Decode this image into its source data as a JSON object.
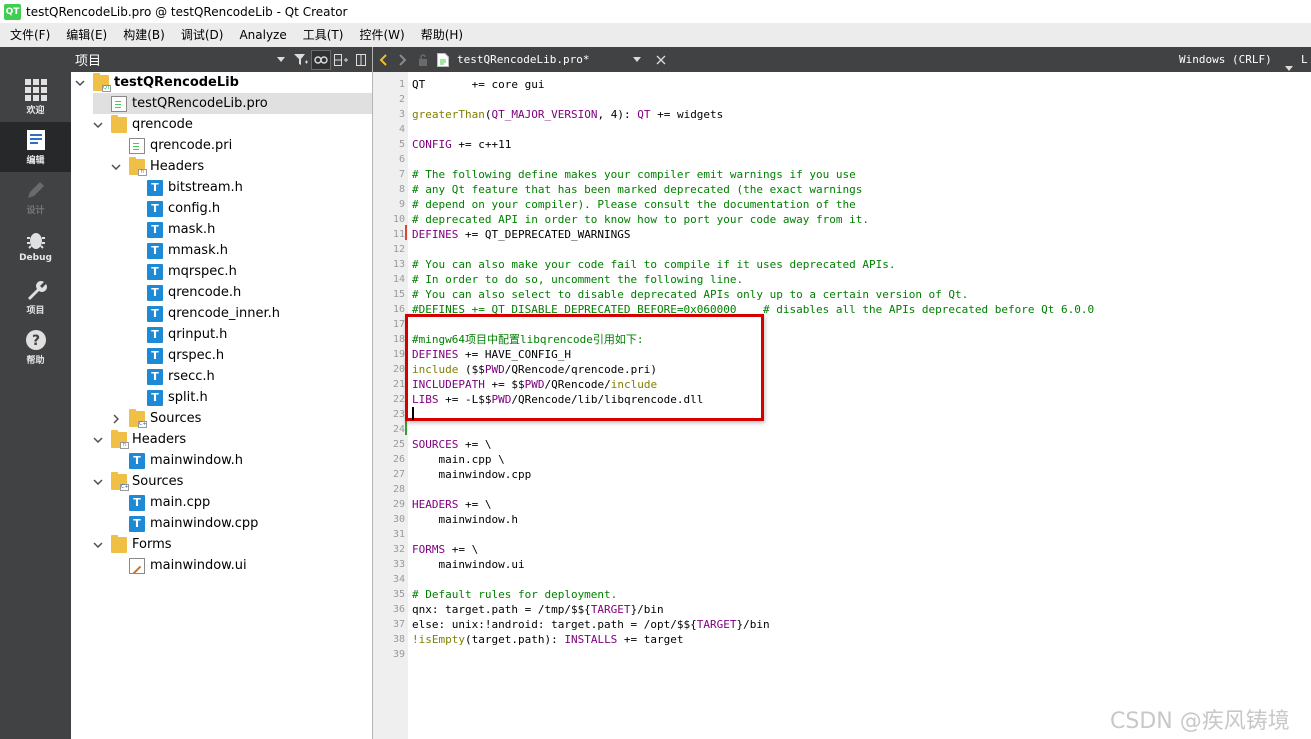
{
  "window": {
    "logo": "QT",
    "title": "testQRencodeLib.pro @ testQRencodeLib - Qt Creator"
  },
  "menubar": [
    "文件(F)",
    "编辑(E)",
    "构建(B)",
    "调试(D)",
    "Analyze",
    "工具(T)",
    "控件(W)",
    "帮助(H)"
  ],
  "modes": [
    {
      "label": "欢迎",
      "icon": "grid-icon",
      "active": false,
      "disabled": false
    },
    {
      "label": "编辑",
      "icon": "edit-icon",
      "active": true,
      "disabled": false
    },
    {
      "label": "设计",
      "icon": "pencil-icon",
      "active": false,
      "disabled": true
    },
    {
      "label": "Debug",
      "icon": "bug-icon",
      "active": false,
      "disabled": false
    },
    {
      "label": "项目",
      "icon": "wrench-icon",
      "active": false,
      "disabled": false
    },
    {
      "label": "帮助",
      "icon": "help-icon",
      "active": false,
      "disabled": false
    }
  ],
  "project_pane": {
    "title": "项目",
    "tree": [
      {
        "label": "testQRencodeLib",
        "icon": "project-folder-icon",
        "level": 0,
        "expanded": true,
        "bold": true
      },
      {
        "label": "testQRencodeLib.pro",
        "icon": "pro-file-icon",
        "level": 1,
        "selected": true
      },
      {
        "label": "qrencode",
        "icon": "folder-icon",
        "level": 1,
        "expanded": true
      },
      {
        "label": "qrencode.pri",
        "icon": "pri-file-icon",
        "level": 2
      },
      {
        "label": "Headers",
        "icon": "headers-folder-icon",
        "level": 2,
        "expanded": true
      },
      {
        "label": "bitstream.h",
        "icon": "header-file-icon",
        "level": 3
      },
      {
        "label": "config.h",
        "icon": "header-file-icon",
        "level": 3
      },
      {
        "label": "mask.h",
        "icon": "header-file-icon",
        "level": 3
      },
      {
        "label": "mmask.h",
        "icon": "header-file-icon",
        "level": 3
      },
      {
        "label": "mqrspec.h",
        "icon": "header-file-icon",
        "level": 3
      },
      {
        "label": "qrencode.h",
        "icon": "header-file-icon",
        "level": 3
      },
      {
        "label": "qrencode_inner.h",
        "icon": "header-file-icon",
        "level": 3
      },
      {
        "label": "qrinput.h",
        "icon": "header-file-icon",
        "level": 3
      },
      {
        "label": "qrspec.h",
        "icon": "header-file-icon",
        "level": 3
      },
      {
        "label": "rsecc.h",
        "icon": "header-file-icon",
        "level": 3
      },
      {
        "label": "split.h",
        "icon": "header-file-icon",
        "level": 3
      },
      {
        "label": "Sources",
        "icon": "sources-folder-icon",
        "level": 2,
        "expanded": false
      },
      {
        "label": "Headers",
        "icon": "headers-folder-icon",
        "level": 1,
        "expanded": true
      },
      {
        "label": "mainwindow.h",
        "icon": "header-file-icon",
        "level": 2
      },
      {
        "label": "Sources",
        "icon": "sources-folder-icon",
        "level": 1,
        "expanded": true
      },
      {
        "label": "main.cpp",
        "icon": "header-file-icon",
        "level": 2
      },
      {
        "label": "mainwindow.cpp",
        "icon": "header-file-icon",
        "level": 2
      },
      {
        "label": "Forms",
        "icon": "forms-folder-icon",
        "level": 1,
        "expanded": true
      },
      {
        "label": "mainwindow.ui",
        "icon": "ui-file-icon",
        "level": 2
      }
    ]
  },
  "editor": {
    "file_tab": "testQRencodeLib.pro*",
    "line_ending": "Windows (CRLF)",
    "encoding_mark": "L",
    "lines": [
      [
        [
          "QT       += core gui",
          "plain"
        ]
      ],
      [],
      [
        [
          "greaterThan",
          "fn"
        ],
        [
          "(",
          "plain"
        ],
        [
          "QT_MAJOR_VERSION",
          "kw"
        ],
        [
          ", 4): ",
          "plain"
        ],
        [
          "QT",
          "kw"
        ],
        [
          " += widgets",
          "plain"
        ]
      ],
      [],
      [
        [
          "CONFIG",
          "kw"
        ],
        [
          " += c++11",
          "plain"
        ]
      ],
      [],
      [
        [
          "# The following define makes your compiler emit warnings if you use",
          "cmt"
        ]
      ],
      [
        [
          "# any Qt feature that has been marked deprecated (the exact warnings",
          "cmt"
        ]
      ],
      [
        [
          "# depend on your compiler). Please consult the documentation of the",
          "cmt"
        ]
      ],
      [
        [
          "# deprecated API in order to know how to port your code away from it.",
          "cmt"
        ]
      ],
      [
        [
          "DEFINES",
          "kw"
        ],
        [
          " += QT_DEPRECATED_WARNINGS",
          "plain"
        ]
      ],
      [],
      [
        [
          "# You can also make your code fail to compile if it uses deprecated APIs.",
          "cmt"
        ]
      ],
      [
        [
          "# In order to do so, uncomment the following line.",
          "cmt"
        ]
      ],
      [
        [
          "# You can also select to disable deprecated APIs only up to a certain version of Qt.",
          "cmt"
        ]
      ],
      [
        [
          "#DEFINES += QT_DISABLE_DEPRECATED_BEFORE=0x060000    # disables all the APIs deprecated before Qt 6.0.0",
          "cmt"
        ]
      ],
      [],
      [
        [
          "#mingw64项目中配置libqrencode引用如下:",
          "cmt"
        ]
      ],
      [
        [
          "DEFINES",
          "kw"
        ],
        [
          " += HAVE_CONFIG_H",
          "plain"
        ]
      ],
      [
        [
          "include",
          "fn"
        ],
        [
          " ($$",
          "plain"
        ],
        [
          "PWD",
          "kw"
        ],
        [
          "/QRencode/qrencode.pri)",
          "plain"
        ]
      ],
      [
        [
          "INCLUDEPATH",
          "kw"
        ],
        [
          " += $$",
          "plain"
        ],
        [
          "PWD",
          "kw"
        ],
        [
          "/QRencode/",
          "plain"
        ],
        [
          "include",
          "pth"
        ]
      ],
      [
        [
          "LIBS",
          "kw"
        ],
        [
          " += -L$$",
          "plain"
        ],
        [
          "PWD",
          "kw"
        ],
        [
          "/QRencode/lib/libqrencode.dll",
          "plain"
        ]
      ],
      [],
      [],
      [
        [
          "SOURCES",
          "kw"
        ],
        [
          " += \\",
          "plain"
        ]
      ],
      [
        [
          "    main.cpp \\",
          "plain"
        ]
      ],
      [
        [
          "    mainwindow.cpp",
          "plain"
        ]
      ],
      [],
      [
        [
          "HEADERS",
          "kw"
        ],
        [
          " += \\",
          "plain"
        ]
      ],
      [
        [
          "    mainwindow.h",
          "plain"
        ]
      ],
      [],
      [
        [
          "FORMS",
          "kw"
        ],
        [
          " += \\",
          "plain"
        ]
      ],
      [
        [
          "    mainwindow.ui",
          "plain"
        ]
      ],
      [],
      [
        [
          "# Default rules for deployment.",
          "cmt"
        ]
      ],
      [
        [
          "qnx: target.path = /tmp/$${",
          "plain"
        ],
        [
          "TARGET",
          "kw"
        ],
        [
          "}/bin",
          "plain"
        ]
      ],
      [
        [
          "else: unix:!android: target.path = /opt/$${",
          "plain"
        ],
        [
          "TARGET",
          "kw"
        ],
        [
          "}/bin",
          "plain"
        ]
      ],
      [
        [
          "!isEmpty",
          "fn"
        ],
        [
          "(target.path): ",
          "plain"
        ],
        [
          "INSTALLS",
          "kw"
        ],
        [
          " += target",
          "plain"
        ]
      ],
      []
    ]
  },
  "watermark": "CSDN @疾风铸境",
  "colors": {
    "keyword": "#800080",
    "function": "#808000",
    "comment": "#008000",
    "highlight_box": "#d40000",
    "sidebar": "#404244"
  }
}
